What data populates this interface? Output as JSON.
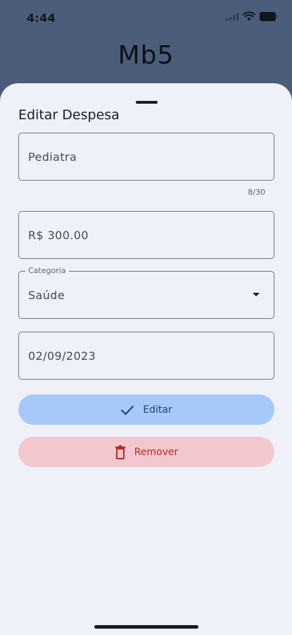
{
  "status_bar": {
    "time": "4:44"
  },
  "app_header": {
    "title": "Mb5"
  },
  "sheet": {
    "title": "Editar Despesa",
    "fields": {
      "name": {
        "value": "Pediatra",
        "counter": "8/30"
      },
      "amount": {
        "value": "R$ 300.00"
      },
      "category": {
        "label": "Categoria",
        "value": "Saúde"
      },
      "date": {
        "value": "02/09/2023"
      }
    },
    "buttons": {
      "edit_label": "Editar",
      "remove_label": "Remover"
    }
  },
  "icons": {
    "edit_button": "check-icon",
    "remove_button": "trash-icon",
    "category_dropdown": "arrow-drop-down-icon"
  },
  "colors": {
    "header_bg": "#4b5d7a",
    "sheet_bg": "#eef2f8",
    "edit_button_bg": "#a6c9fa",
    "edit_button_text": "#1e3f6e",
    "remove_button_bg": "#f2c8ce",
    "remove_button_text": "#c4231f"
  }
}
